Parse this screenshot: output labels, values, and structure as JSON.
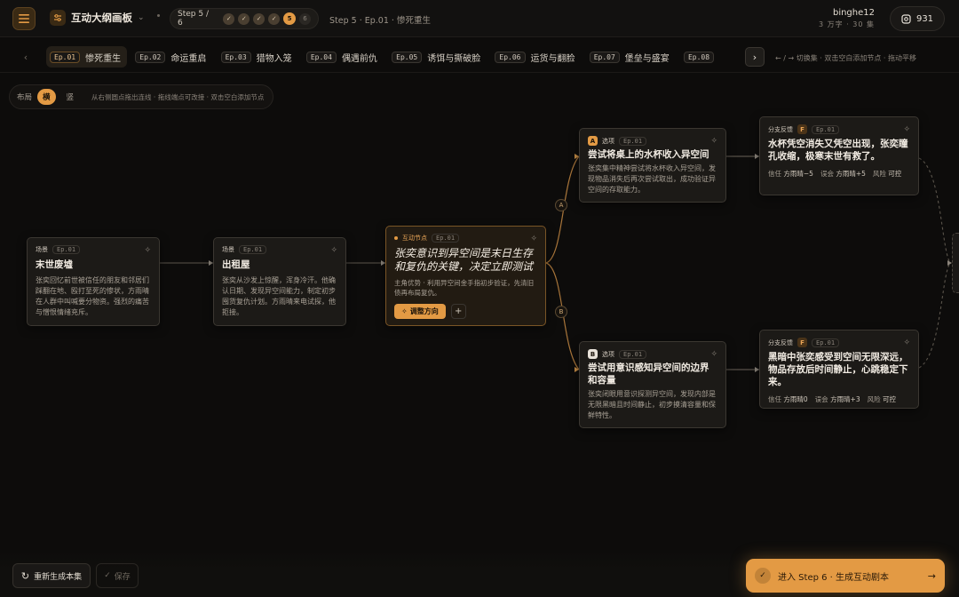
{
  "colors": {
    "accent": "#e39a44",
    "background": "#0d0c0b",
    "card": "#1c1a17"
  },
  "header": {
    "menu_icon": "hamburger-icon",
    "title": "互动大纲画板",
    "step_label": "Step 5 / 6",
    "steps": [
      "✓",
      "✓",
      "✓",
      "✓",
      "5",
      "6"
    ],
    "breadcrumb": "Step 5 · Ep.01 · 惨死重生",
    "user_name": "binghe12",
    "user_meta": "3 万字 · 30 集",
    "credits": "931"
  },
  "episodes": [
    {
      "code": "Ep.01",
      "name": "惨死重生"
    },
    {
      "code": "Ep.02",
      "name": "命运重启"
    },
    {
      "code": "Ep.03",
      "name": "猎物入笼"
    },
    {
      "code": "Ep.04",
      "name": "偶遇前仇"
    },
    {
      "code": "Ep.05",
      "name": "诱饵与撕破脸"
    },
    {
      "code": "Ep.06",
      "name": "运货与翻脸"
    },
    {
      "code": "Ep.07",
      "name": "堡垒与盛宴"
    },
    {
      "code": "Ep.08",
      "name": ""
    }
  ],
  "episode_hint": "← / → 切换集 · 双击空白添加节点 · 拖动平移",
  "toolbar": {
    "layout_label": "布局",
    "horizontal": "横",
    "vertical": "竖",
    "hint": "从右侧圆点拖出连线 · 拖线端点可改接 · 双击空白添加节点"
  },
  "nodes": {
    "scene1": {
      "type": "场景",
      "ep": "Ep.01",
      "title": "末世废墟",
      "body": "张奕回忆前世被信任的朋友和邻居们踩翻在地、殴打至死的惨状，方雨晴在人群中叫喊要分物资。强烈的痛苦与憎恨情绪充斥。"
    },
    "scene2": {
      "type": "场景",
      "ep": "Ep.01",
      "title": "出租屋",
      "body": "张奕从沙发上惊醒，浑身冷汗。他确认日期、发现异空间能力，制定初步囤货复仇计划。方雨晴来电试探，他拒接。"
    },
    "hub": {
      "type": "互动节点",
      "ep": "Ep.01",
      "title": "张奕意识到异空间是末日生存和复仇的关键，决定立即测试",
      "body": "主角优势 · 利用异空间金手指初步验证，先清旧债再布局复仇。",
      "adjust": "调整方向",
      "add": "+"
    },
    "optA": {
      "badge": "A",
      "type": "选项",
      "ep": "Ep.01",
      "title": "尝试将桌上的水杯收入异空间",
      "body": "张奕集中精神尝试将水杯收入异空间，发现物品消失后再次尝试取出，成功验证异空间的存取能力。"
    },
    "optB": {
      "badge": "B",
      "type": "选项",
      "ep": "Ep.01",
      "title": "尝试用意识感知异空间的边界和容量",
      "body": "张奕闭眼用意识探测异空间，发现内部是无限黑暗且时间静止，初步摸清容量和保鲜特性。"
    },
    "fbA": {
      "type": "分支反馈",
      "badge": "F",
      "ep": "Ep.01",
      "title": "水杯凭空消失又凭空出现，张奕瞳孔收缩，极寒末世有救了。",
      "stats": [
        {
          "k": "信任",
          "v": "方雨晴−5"
        },
        {
          "k": "误会",
          "v": "方雨晴+5"
        },
        {
          "k": "风险",
          "v": "可控"
        }
      ]
    },
    "fbB": {
      "type": "分支反馈",
      "badge": "F",
      "ep": "Ep.01",
      "title": "黑暗中张奕感受到空间无限深远，物品存放后时间静止，心跳稳定下来。",
      "stats": [
        {
          "k": "信任",
          "v": "方雨晴0"
        },
        {
          "k": "误会",
          "v": "方雨晴+3"
        },
        {
          "k": "风险",
          "v": "可控"
        }
      ]
    }
  },
  "edge_labels": {
    "a": "A",
    "b": "B"
  },
  "bottom": {
    "regenerate": "重新生成本集",
    "save": "保存",
    "enter": "进入 Step 6 · 生成互动剧本"
  }
}
